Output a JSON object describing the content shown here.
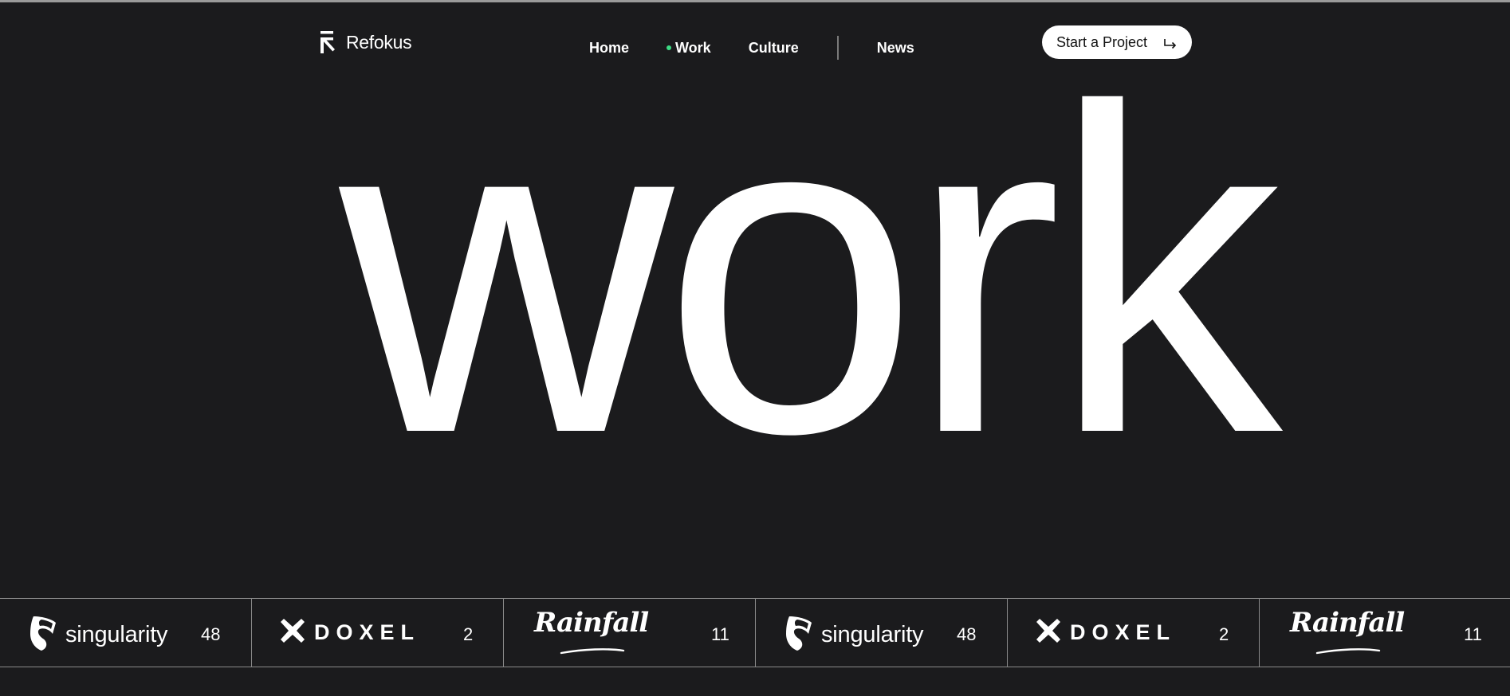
{
  "brand": {
    "name": "Refokus",
    "logo_icon": "refokus-arrow-icon"
  },
  "nav": {
    "links": [
      {
        "label": "Home",
        "active": false
      },
      {
        "label": "Work",
        "active": true
      },
      {
        "label": "Culture",
        "active": false
      },
      {
        "label": "News",
        "active": false
      }
    ],
    "active_indicator_color": "#3ddc84"
  },
  "cta": {
    "label": "Start a Project",
    "icon": "corner-down-right-arrow-icon"
  },
  "hero": {
    "title": "work"
  },
  "clients": [
    {
      "name": "singularity",
      "count": "48",
      "icon": "singularity-logo-icon"
    },
    {
      "name": "DOXEL",
      "count": "2",
      "icon": "doxel-x-icon"
    },
    {
      "name": "Rainfall",
      "count": "11",
      "icon": "rainfall-logo"
    },
    {
      "name": "singularity",
      "count": "48",
      "icon": "singularity-logo-icon"
    },
    {
      "name": "DOXEL",
      "count": "2",
      "icon": "doxel-x-icon"
    },
    {
      "name": "Rainfall",
      "count": "11",
      "icon": "rainfall-logo"
    }
  ],
  "colors": {
    "background": "#1b1b1d",
    "foreground": "#ffffff",
    "divider": "#8a8a8a"
  }
}
